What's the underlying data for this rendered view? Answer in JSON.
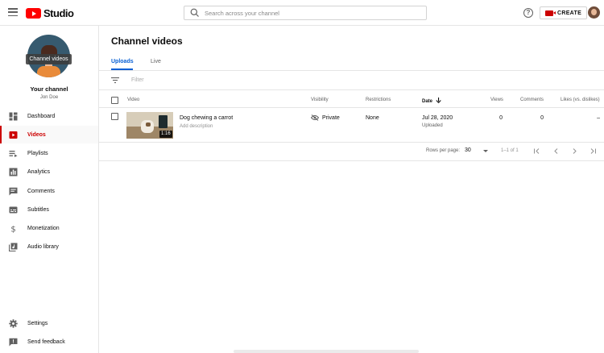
{
  "header": {
    "brand": "Studio",
    "search_placeholder": "Search across your channel",
    "help_glyph": "?",
    "create_label": "CREATE"
  },
  "sidebar": {
    "avatar_overlay": "Channel videos",
    "channel_title": "Your channel",
    "owner_name": "Jon Doe",
    "items": [
      {
        "label": "Dashboard",
        "icon": "dashboard-icon"
      },
      {
        "label": "Videos",
        "icon": "videos-icon",
        "active": true
      },
      {
        "label": "Playlists",
        "icon": "playlists-icon"
      },
      {
        "label": "Analytics",
        "icon": "analytics-icon"
      },
      {
        "label": "Comments",
        "icon": "comments-icon"
      },
      {
        "label": "Subtitles",
        "icon": "subtitles-icon"
      },
      {
        "label": "Monetization",
        "icon": "monetization-icon"
      },
      {
        "label": "Audio library",
        "icon": "audio-library-icon"
      }
    ],
    "bottom_items": [
      {
        "label": "Settings",
        "icon": "settings-icon"
      },
      {
        "label": "Send feedback",
        "icon": "feedback-icon"
      }
    ]
  },
  "main": {
    "title": "Channel videos",
    "tabs": [
      {
        "label": "Uploads",
        "active": true
      },
      {
        "label": "Live"
      }
    ],
    "filter_placeholder": "Filter",
    "columns": {
      "video": "Video",
      "visibility": "Visibility",
      "restrictions": "Restrictions",
      "date": "Date",
      "views": "Views",
      "comments": "Comments",
      "likes": "Likes (vs. dislikes)"
    },
    "rows": [
      {
        "title": "Dog chewing a carrot",
        "description": "Add description",
        "duration": "1:16",
        "visibility": "Private",
        "restrictions": "None",
        "date": "Jul 28, 2020",
        "date_status": "Uploaded",
        "views": "0",
        "comments": "0",
        "likes": "–"
      }
    ],
    "pagination": {
      "rows_per_page_label": "Rows per page:",
      "rows_per_page_value": "30",
      "range": "1–1 of 1"
    }
  },
  "colors": {
    "brand_red": "#ff0000",
    "accent_red": "#cc0000",
    "link_blue": "#065fd4"
  }
}
